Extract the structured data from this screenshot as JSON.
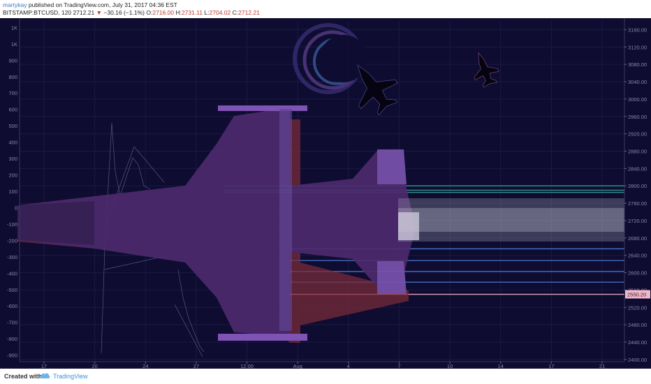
{
  "header": {
    "author": "martykay",
    "published_text": "published on TradingView.com, July 31, 2017 04:36 EST",
    "symbol": "BITSTAMP:BTCUSD, 120",
    "last_price": "2712.21",
    "change_arrow": "▼",
    "change": "−30.16 (−1.1%)",
    "o_label": "O:",
    "o_value": "2716.00",
    "h_label": "H:",
    "h_value": "2731.11",
    "l_label": "L:",
    "l_value": "2704.02",
    "c_label": "C:",
    "c_value": "2712.21"
  },
  "footer": {
    "created_with": "Created with",
    "brand": "TradingView"
  },
  "colors": {
    "background": "#0e0c30",
    "price_tag": "#f2b8c8",
    "fib_blue": "#4a78d0",
    "fib_teal": "#3aa69a",
    "jet_purple": "#5a2f7a"
  },
  "chart_data": {
    "type": "line",
    "symbol": "BTCUSD",
    "interval": "120",
    "x_ticks": [
      "17",
      "20",
      "24",
      "27",
      "12:00",
      "Aug",
      "4",
      "7",
      "10",
      "14",
      "17",
      "21"
    ],
    "right_axis": {
      "ticks": [
        3160,
        3120,
        3080,
        3040,
        3000,
        2960,
        2920,
        2880,
        2840,
        2800,
        2760,
        2720,
        2680,
        2640,
        2600,
        2560,
        2520,
        2480,
        2440,
        2400
      ],
      "tick_labels": [
        "3160.00",
        "3120.00",
        "3080.00",
        "3040.00",
        "3000.00",
        "2960.00",
        "2920.00",
        "2880.00",
        "2840.00",
        "2800.00",
        "2760.00",
        "2720.00",
        "2680.00",
        "2640.00",
        "2600.00",
        "2560.00",
        "2520.00",
        "2480.00",
        "2440.00",
        "2400.00"
      ],
      "range": [
        2395,
        3180
      ],
      "price_tag": "2550.20"
    },
    "left_axis": {
      "tick_labels": [
        "1K",
        "1K",
        "900",
        "800",
        "700",
        "600",
        "500",
        "400",
        "300",
        "200",
        "100",
        "0",
        "-100",
        "-200",
        "-300",
        "-400",
        "-500",
        "-600",
        "-700",
        "-800",
        "-900"
      ],
      "range": [
        -940,
        1140
      ]
    },
    "horizontal_levels": [
      {
        "price": 2800,
        "color": "#3aa69a"
      },
      {
        "price": 2790,
        "color": "#3aa69a"
      },
      {
        "price": 2785,
        "color": "#3aa69a"
      },
      {
        "price": 2655,
        "color": "#4a78d0"
      },
      {
        "price": 2628,
        "color": "#4a78d0"
      },
      {
        "price": 2603,
        "color": "#4a78d0"
      },
      {
        "price": 2578,
        "color": "#4a78d0"
      },
      {
        "price": 2550.2,
        "color": "#f2b8c8"
      }
    ],
    "grid": true
  }
}
